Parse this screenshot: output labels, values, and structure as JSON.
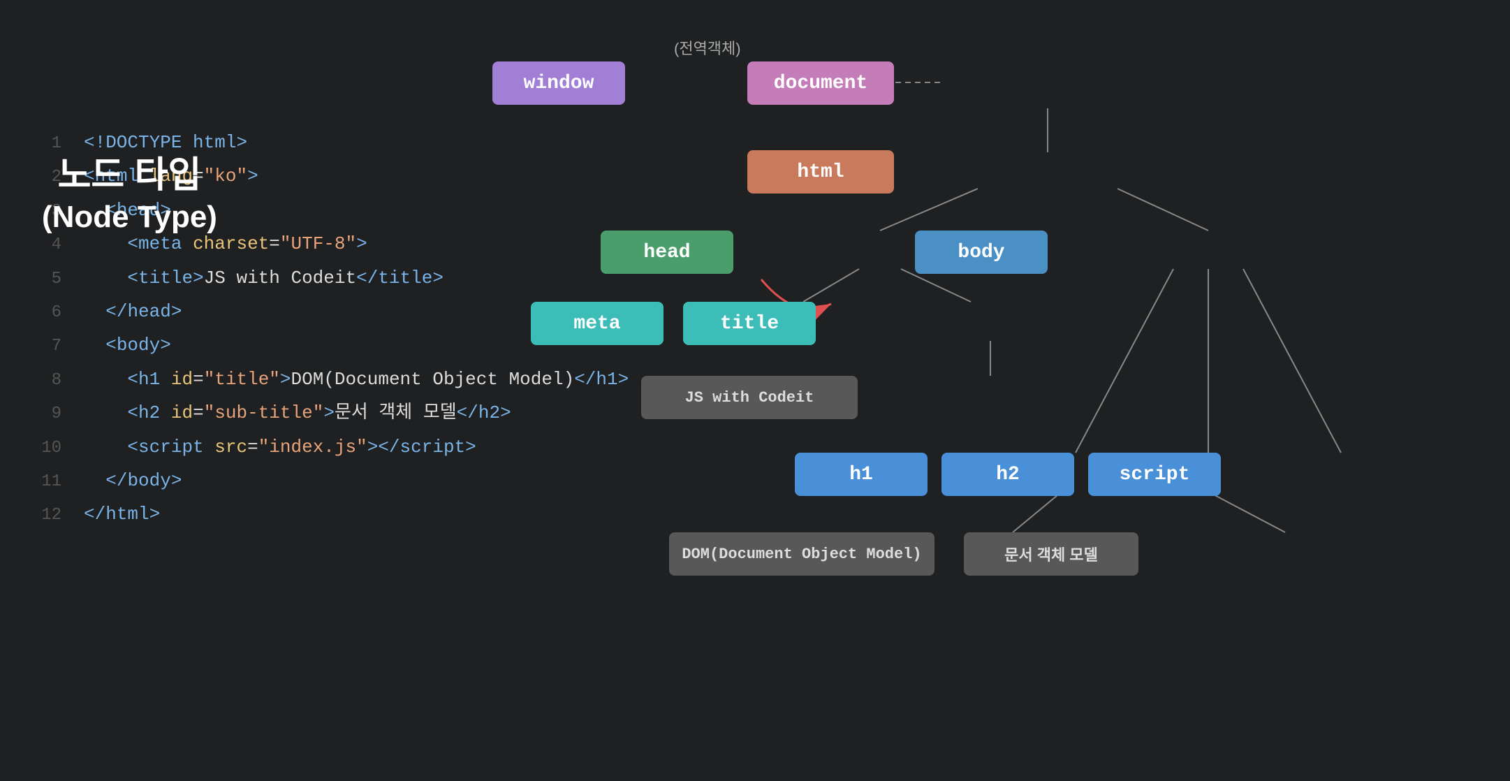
{
  "background": "#1e2022",
  "code": {
    "lines": [
      {
        "num": "1",
        "html": "<span class='tag-bracket'>&lt;!DOCTYPE </span><span class='tag-name'>html</span><span class='tag-bracket'>&gt;</span>"
      },
      {
        "num": "2",
        "html": "<span class='tag-bracket'>&lt;</span><span class='tag-name'>html</span> <span class='attr-name'>lang</span>=<span class='attr-value'>\"ko\"</span><span class='tag-bracket'>&gt;</span>"
      },
      {
        "num": "3",
        "html": "  <span class='tag-bracket'>&lt;</span><span class='tag-name'>head</span><span class='tag-bracket'>&gt;</span>"
      },
      {
        "num": "4",
        "html": "    <span class='tag-bracket'>&lt;</span><span class='tag-name'>meta</span> <span class='attr-name'>charset</span>=<span class='attr-value'>\"UTF-8\"</span><span class='tag-bracket'>&gt;</span>"
      },
      {
        "num": "5",
        "html": "    <span class='tag-bracket'>&lt;</span><span class='tag-name'>title</span><span class='tag-bracket'>&gt;</span><span class='text-content'>JS with Codeit</span><span class='tag-bracket'>&lt;/</span><span class='tag-name'>title</span><span class='tag-bracket'>&gt;</span>"
      },
      {
        "num": "6",
        "html": "  <span class='tag-bracket'>&lt;/</span><span class='tag-name'>head</span><span class='tag-bracket'>&gt;</span>"
      },
      {
        "num": "7",
        "html": "  <span class='tag-bracket'>&lt;</span><span class='tag-name'>body</span><span class='tag-bracket'>&gt;</span>"
      },
      {
        "num": "8",
        "html": "    <span class='tag-bracket'>&lt;</span><span class='tag-name'>h1</span> <span class='attr-name'>id</span>=<span class='attr-value'>\"title\"</span><span class='tag-bracket'>&gt;</span><span class='text-content'>DOM(Document Object Model)</span><span class='tag-bracket'>&lt;/</span><span class='tag-name'>h1</span><span class='tag-bracket'>&gt;</span>"
      },
      {
        "num": "9",
        "html": "    <span class='tag-bracket'>&lt;</span><span class='tag-name'>h2</span> <span class='attr-name'>id</span>=<span class='attr-value'>\"sub-title\"</span><span class='tag-bracket'>&gt;</span><span class='text-content'>문서 객체 모델</span><span class='tag-bracket'>&lt;/</span><span class='tag-name'>h2</span><span class='tag-bracket'>&gt;</span>"
      },
      {
        "num": "10",
        "html": "    <span class='tag-bracket'>&lt;</span><span class='tag-name'>script</span> <span class='attr-name'>src</span>=<span class='attr-value'>\"index.js\"</span><span class='tag-bracket'>&gt;&lt;/</span><span class='tag-name'>script</span><span class='tag-bracket'>&gt;</span>"
      },
      {
        "num": "11",
        "html": "  <span class='tag-bracket'>&lt;/</span><span class='tag-name'>body</span><span class='tag-bracket'>&gt;</span>"
      },
      {
        "num": "12",
        "html": "<span class='tag-bracket'>&lt;/</span><span class='tag-name'>html</span><span class='tag-bracket'>&gt;</span>"
      }
    ]
  },
  "node_type_label": {
    "korean": "노드 타입",
    "english": "(Node Type)"
  },
  "diagram": {
    "global_label": "(전역객체)",
    "nodes": {
      "window": {
        "label": "window"
      },
      "document": {
        "label": "document"
      },
      "html": {
        "label": "html"
      },
      "head": {
        "label": "head"
      },
      "body": {
        "label": "body"
      },
      "meta": {
        "label": "meta"
      },
      "title": {
        "label": "title"
      },
      "text_js": {
        "label": "JS with Codeit"
      },
      "h1": {
        "label": "h1"
      },
      "h2": {
        "label": "h2"
      },
      "script": {
        "label": "script"
      },
      "text_dom": {
        "label": "DOM(Document Object Model)"
      },
      "text_문서": {
        "label": "문서 객체 모델"
      }
    }
  }
}
